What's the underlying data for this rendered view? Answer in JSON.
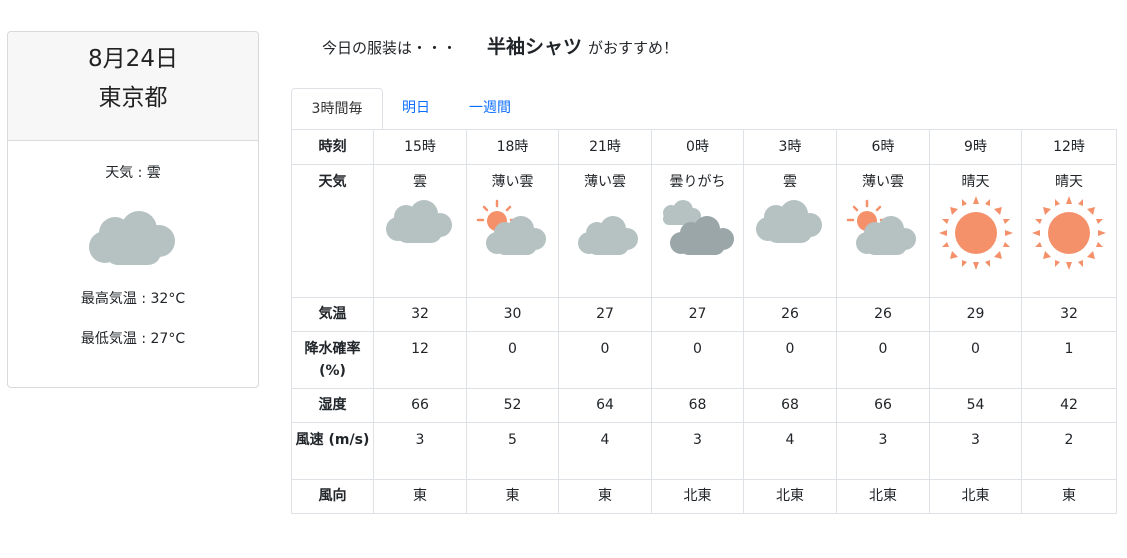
{
  "summary": {
    "date": "8月24日",
    "city": "東京都",
    "weather": "天気 : 雲",
    "weather_icon": "cloud-icon",
    "max_temp": "最高気温 : 32°C",
    "min_temp": "最低気温 : 27°C"
  },
  "recommend": {
    "prefix": "今日の服装は・・・",
    "item": "半袖シャツ",
    "suffix": "がおすすめ！"
  },
  "tabs": [
    {
      "label": "3時間毎",
      "active": true
    },
    {
      "label": "明日",
      "active": false
    },
    {
      "label": "一週間",
      "active": false
    }
  ],
  "table": {
    "row_labels": {
      "time": "時刻",
      "weather": "天気",
      "temp": "気温",
      "rain": "降水確率 (%)",
      "humidity": "湿度",
      "wind": "風速 (m/s)",
      "direction": "風向"
    },
    "columns": [
      {
        "time": "15時",
        "weather": "雲",
        "icon": "cloud-icon",
        "temp": "32",
        "rain": "12",
        "humidity": "66",
        "wind": "3",
        "direction": "東"
      },
      {
        "time": "18時",
        "weather": "薄い雲",
        "icon": "sun-cloud-icon",
        "temp": "30",
        "rain": "0",
        "humidity": "52",
        "wind": "5",
        "direction": "東"
      },
      {
        "time": "21時",
        "weather": "薄い雲",
        "icon": "moon-cloud-icon",
        "temp": "27",
        "rain": "0",
        "humidity": "64",
        "wind": "4",
        "direction": "東"
      },
      {
        "time": "0時",
        "weather": "曇りがち",
        "icon": "dark-clouds-icon",
        "temp": "27",
        "rain": "0",
        "humidity": "68",
        "wind": "3",
        "direction": "北東"
      },
      {
        "time": "3時",
        "weather": "雲",
        "icon": "cloud-icon",
        "temp": "26",
        "rain": "0",
        "humidity": "68",
        "wind": "4",
        "direction": "北東"
      },
      {
        "time": "6時",
        "weather": "薄い雲",
        "icon": "sun-cloud-icon",
        "temp": "26",
        "rain": "0",
        "humidity": "66",
        "wind": "3",
        "direction": "北東"
      },
      {
        "time": "9時",
        "weather": "晴天",
        "icon": "sun-icon",
        "temp": "29",
        "rain": "0",
        "humidity": "54",
        "wind": "3",
        "direction": "北東"
      },
      {
        "time": "12時",
        "weather": "晴天",
        "icon": "sun-icon",
        "temp": "32",
        "rain": "1",
        "humidity": "42",
        "wind": "2",
        "direction": "東"
      }
    ]
  },
  "colors": {
    "cloud": "#b5c2c1",
    "dark_cloud": "#9aa6a8",
    "sun": "#f4916b",
    "moon": "#f3c45a",
    "link": "#0d6efd",
    "border": "#dee2e6"
  }
}
